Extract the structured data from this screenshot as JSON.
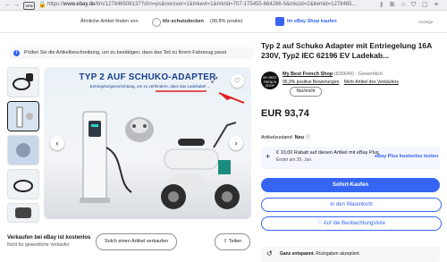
{
  "browser": {
    "back_icon": "arrow-left-icon",
    "vpn_label": "VPN",
    "url_prefix": "https://",
    "url_host": "www.ebay.de",
    "url_rest": "/itm/127846508137?chn=ps&norover=1&mkevt=1&mkrid=707-175455-664266-5&mkcid=2&itemid=1278465..."
  },
  "similar_bar": {
    "text": "Ähnliche Artikel finden von",
    "seller": "kfz-schutzdecken",
    "rating": "(99,8% positiv)",
    "shop_link": "Im eBay Shop kaufen",
    "ad_label": "Anzeige"
  },
  "info_banner": {
    "text": "Prüfen Sie die Artikelbeschreibung, um zu bestätigen, dass das Teil zu Ihrem Fahrzeug passt"
  },
  "image": {
    "promo_title": "TYP 2 AUF SCHUKO-ADAPTER",
    "promo_subtitle": "Entriegelungsvorrichtung, um zu verhindern, dass das Ladekabel ..."
  },
  "sell_row": {
    "heading": "Verkaufen bei eBay ist kostenlos",
    "subtext": "Nicht für gewerbliche Verkäufer",
    "sell_button": "Solch einen Artikel verkaufen",
    "share_button": "Teilen"
  },
  "product": {
    "title": "Typ 2 auf Schuko Adapter mit Entriegelung 16A 230V, Typ2 IEC 62196 EV Ladekab...",
    "seller_logo_text": "MY BEST FRENCH SHOP",
    "seller_name": "My Best French Shop",
    "seller_count": "(836649)",
    "seller_type": "· Gewerblich",
    "seller_rating": "95,9% positive Bewertungen",
    "seller_more": "Mehr Artikel des Verkäufers",
    "message_button": "Nachricht",
    "price": "EUR 93,74",
    "condition_label": "Artikelzustand:",
    "condition_value": "Neu",
    "promo_line1": "€ 10,00 Rabatt auf diesen Artikel mit eBay Plus",
    "promo_line2": "Endet am 30. Jun.",
    "promo_link": "eBay Plus kostenlos testen",
    "buy_now": "Sofort-Kaufen",
    "add_to_cart": "In den Warenkorb",
    "watchlist": "♡ Auf die Beobachtungsliste",
    "returns_bold": "Ganz entspannt.",
    "returns_text": "Rückgaben akzeptiert."
  },
  "colors": {
    "accent": "#3665f3",
    "banner_title": "#1a3f8f",
    "underline_red": "#e0201f"
  }
}
